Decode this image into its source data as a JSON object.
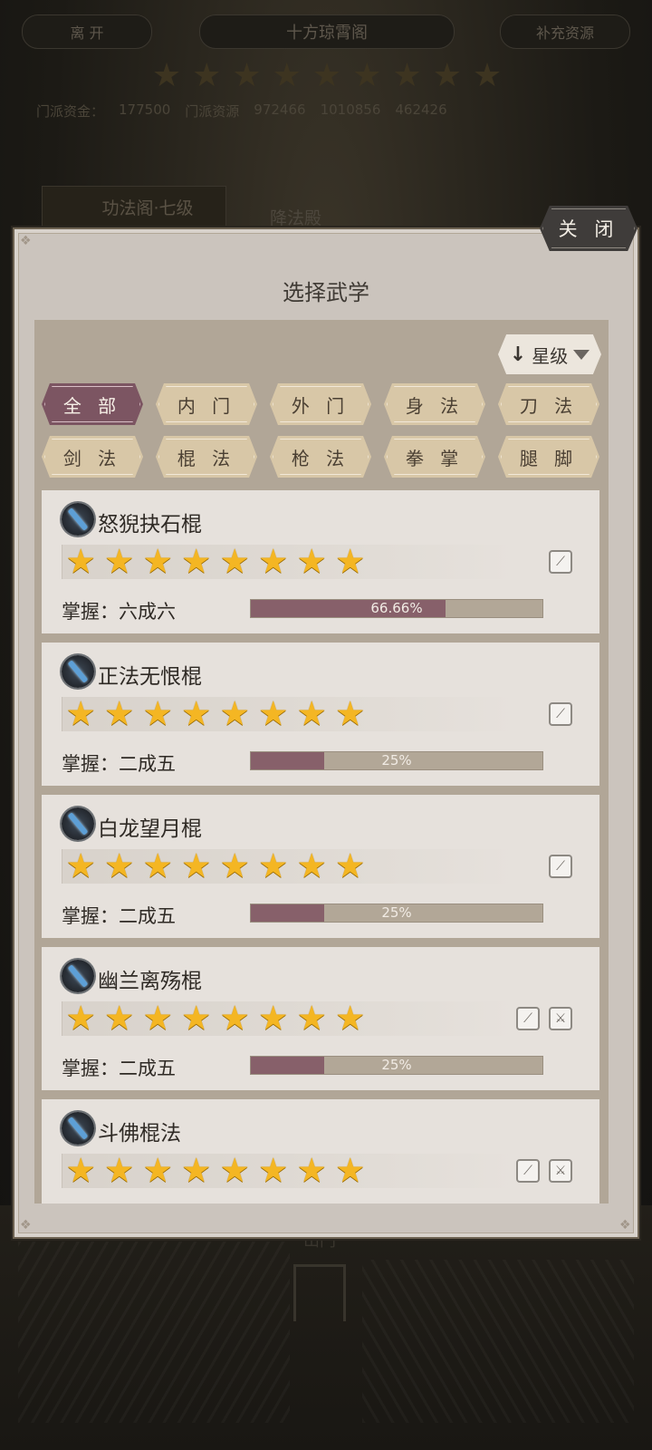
{
  "background": {
    "leave_label": "离 开",
    "hall_title": "十方琼霄阁",
    "supply_label": "补充资源",
    "resources": [
      "门派资金：",
      "177500",
      "门派资源",
      "972466",
      "1010856",
      "462426"
    ],
    "tab_left": "功法阁·七级",
    "tab_right": "降法殿",
    "gate_label": "山门"
  },
  "dialog": {
    "close_label": "关 闭",
    "title": "选择武学",
    "sort_label": "星级",
    "filters": [
      "全 部",
      "内 门",
      "外 门",
      "身 法",
      "刀 法",
      "剑 法",
      "棍 法",
      "枪 法",
      "拳 掌",
      "腿 脚"
    ],
    "active_filter": 0,
    "mastery_prefix": "掌握：",
    "skills": [
      {
        "name": "怒猊抉石棍",
        "stars": 8,
        "mastery": "六成六",
        "progress": 0.6666,
        "progress_label": "66.66%",
        "type_icons": [
          "staff-type-icon"
        ]
      },
      {
        "name": "正法无恨棍",
        "stars": 8,
        "mastery": "二成五",
        "progress": 0.25,
        "progress_label": "25%",
        "type_icons": [
          "staff-type-icon"
        ]
      },
      {
        "name": "白龙望月棍",
        "stars": 8,
        "mastery": "二成五",
        "progress": 0.25,
        "progress_label": "25%",
        "type_icons": [
          "staff-type-icon"
        ]
      },
      {
        "name": "幽兰离殇棍",
        "stars": 8,
        "mastery": "二成五",
        "progress": 0.25,
        "progress_label": "25%",
        "type_icons": [
          "staff-type-icon",
          "sword-type-icon"
        ]
      },
      {
        "name": "斗佛棍法",
        "stars": 8,
        "mastery": "",
        "progress": null,
        "progress_label": "",
        "type_icons": [
          "staff-type-icon",
          "sword-type-icon"
        ]
      }
    ]
  },
  "colors": {
    "active_filter": "#7c5562",
    "filter": "#d8c7a7",
    "bar_fill": "#87606a",
    "bar_track": "#b2a797",
    "star": "#f4b623"
  }
}
